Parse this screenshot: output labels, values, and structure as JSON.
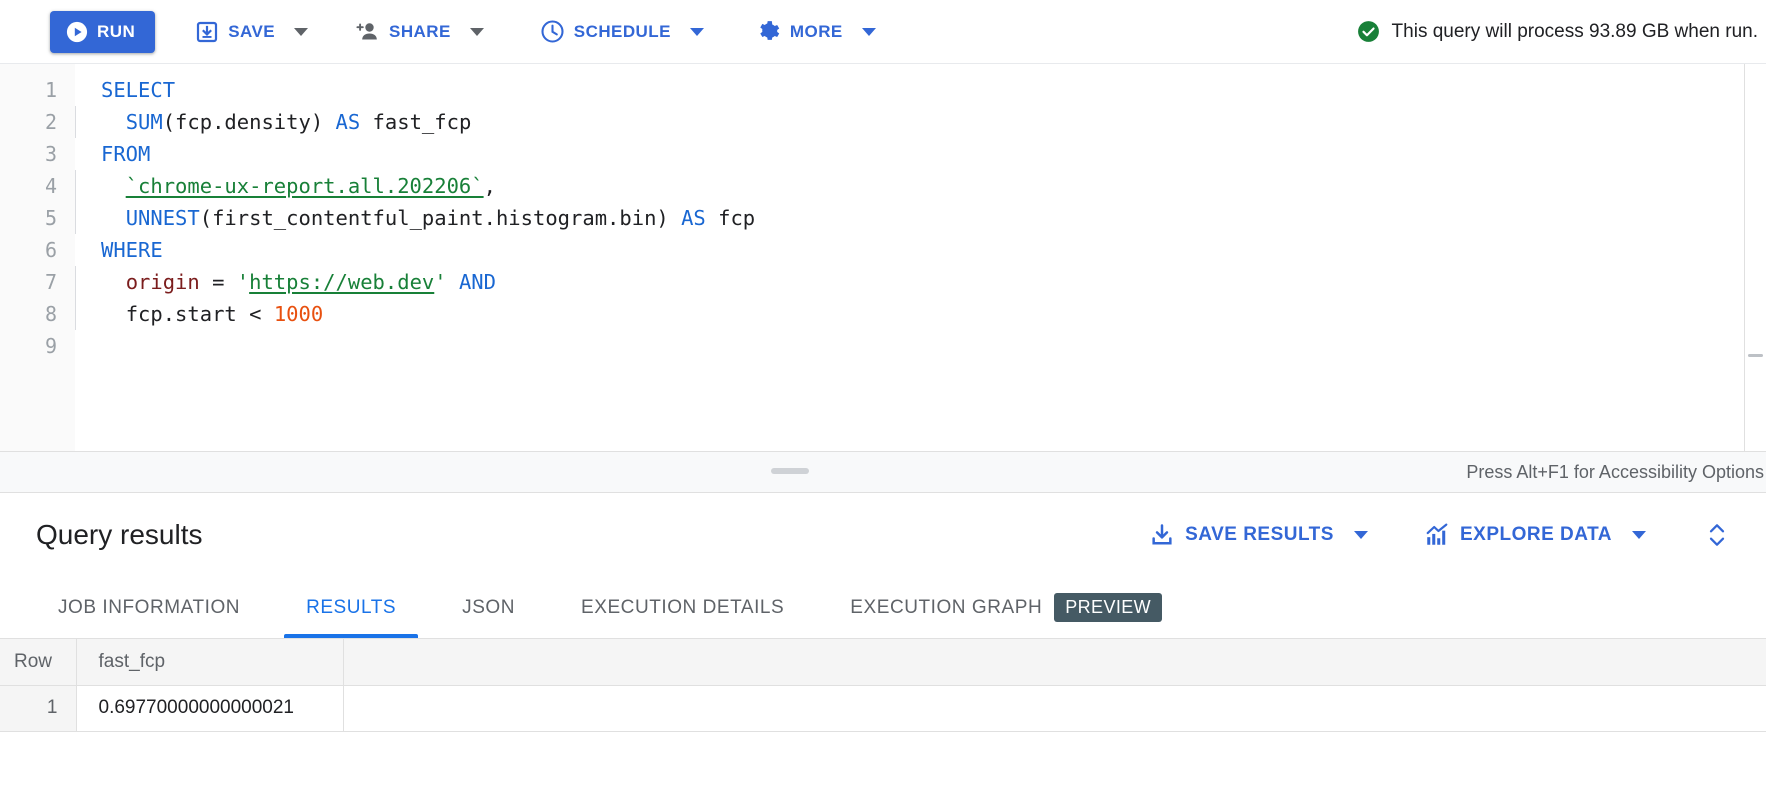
{
  "toolbar": {
    "run_label": "RUN",
    "save_label": "SAVE",
    "share_label": "SHARE",
    "schedule_label": "SCHEDULE",
    "more_label": "MORE",
    "query_note": "This query will process 93.89 GB when run.",
    "accent_blue": "#3367d6",
    "success_green": "#188038"
  },
  "editor": {
    "line_numbers": [
      "1",
      "2",
      "3",
      "4",
      "5",
      "6",
      "7",
      "8",
      "9"
    ],
    "lines": [
      {
        "n": "1",
        "indent": false,
        "text": "SELECT"
      },
      {
        "n": "2",
        "indent": true,
        "text": "  SUM(fcp.density) AS fast_fcp"
      },
      {
        "n": "3",
        "indent": false,
        "text": "FROM"
      },
      {
        "n": "4",
        "indent": true,
        "text": "  `chrome-ux-report.all.202206`,"
      },
      {
        "n": "5",
        "indent": true,
        "text": "  UNNEST(first_contentful_paint.histogram.bin) AS fcp"
      },
      {
        "n": "6",
        "indent": false,
        "text": "WHERE"
      },
      {
        "n": "7",
        "indent": true,
        "text": "  origin = 'https://web.dev' AND"
      },
      {
        "n": "8",
        "indent": true,
        "text": "  fcp.start < 1000"
      },
      {
        "n": "9",
        "indent": false,
        "text": ""
      }
    ],
    "tokens": {
      "select": "SELECT",
      "sum": "SUM",
      "fcp_density": "(fcp.density)",
      "as": "AS",
      "fast_fcp": "fast_fcp",
      "from": "FROM",
      "table_ref": "`chrome-ux-report.all.202206`",
      "comma": ",",
      "unnest": "UNNEST",
      "unnest_arg": "(first_contentful_paint.histogram.bin)",
      "fcp_alias": "fcp",
      "where": "WHERE",
      "origin": "origin",
      "eq": "=",
      "url_open_quote": "'",
      "url": "https://web.dev",
      "url_close_quote": "'",
      "and": "AND",
      "fcp_start": "fcp.start",
      "lt": "<",
      "thousand": "1000"
    },
    "accessibility_hint": "Press Alt+F1 for Accessibility Options"
  },
  "results": {
    "title": "Query results",
    "save_results_label": "SAVE RESULTS",
    "explore_data_label": "EXPLORE DATA",
    "tabs": [
      {
        "label": "JOB INFORMATION",
        "active": false,
        "badge": ""
      },
      {
        "label": "RESULTS",
        "active": true,
        "badge": ""
      },
      {
        "label": "JSON",
        "active": false,
        "badge": ""
      },
      {
        "label": "EXECUTION DETAILS",
        "active": false,
        "badge": ""
      },
      {
        "label": "EXECUTION GRAPH",
        "active": false,
        "badge": "PREVIEW"
      }
    ],
    "table": {
      "columns": [
        "Row",
        "fast_fcp",
        ""
      ],
      "rows": [
        {
          "row": "1",
          "fast_fcp": "0.69770000000000021",
          "filler": ""
        }
      ]
    }
  }
}
